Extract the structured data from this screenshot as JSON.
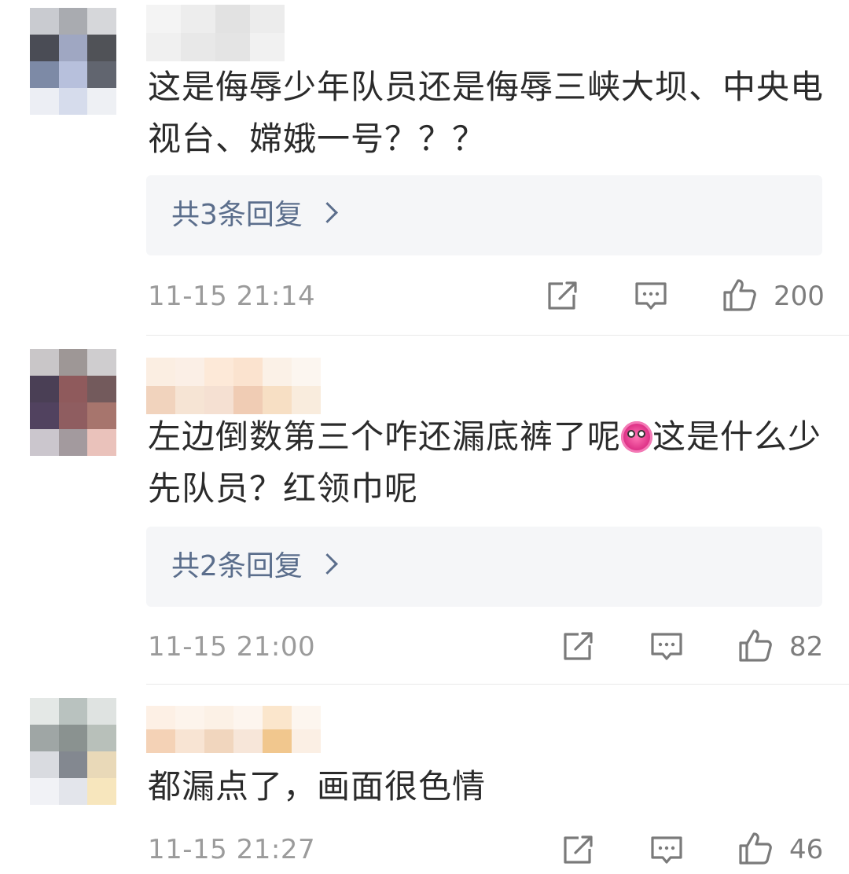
{
  "comments": [
    {
      "text": "这是侮辱少年队员还是侮辱三峡大坝、中央电视台、嫦娥一号？？？",
      "replies_label": "共3条回复",
      "time": "11-15 21:14",
      "like_count": "200"
    },
    {
      "text_before_emoji": "左边倒数第三个咋还漏底裤了呢",
      "emoji": "crazy-face-emoji",
      "text_after_emoji": "这是什么少先队员？红领巾呢",
      "replies_label": "共2条回复",
      "time": "11-15 21:00",
      "like_count": "82"
    },
    {
      "text": "都漏点了，画面很色情",
      "time": "11-15 21:27",
      "like_count": "46"
    }
  ],
  "icons": {
    "share": "share-icon",
    "comment": "comment-icon",
    "like": "thumbs-up-icon"
  },
  "colors": {
    "text": "#2b2b2b",
    "meta": "#9b9b9b",
    "link": "#5b6e8c",
    "reply_bg": "#f5f6f8"
  }
}
